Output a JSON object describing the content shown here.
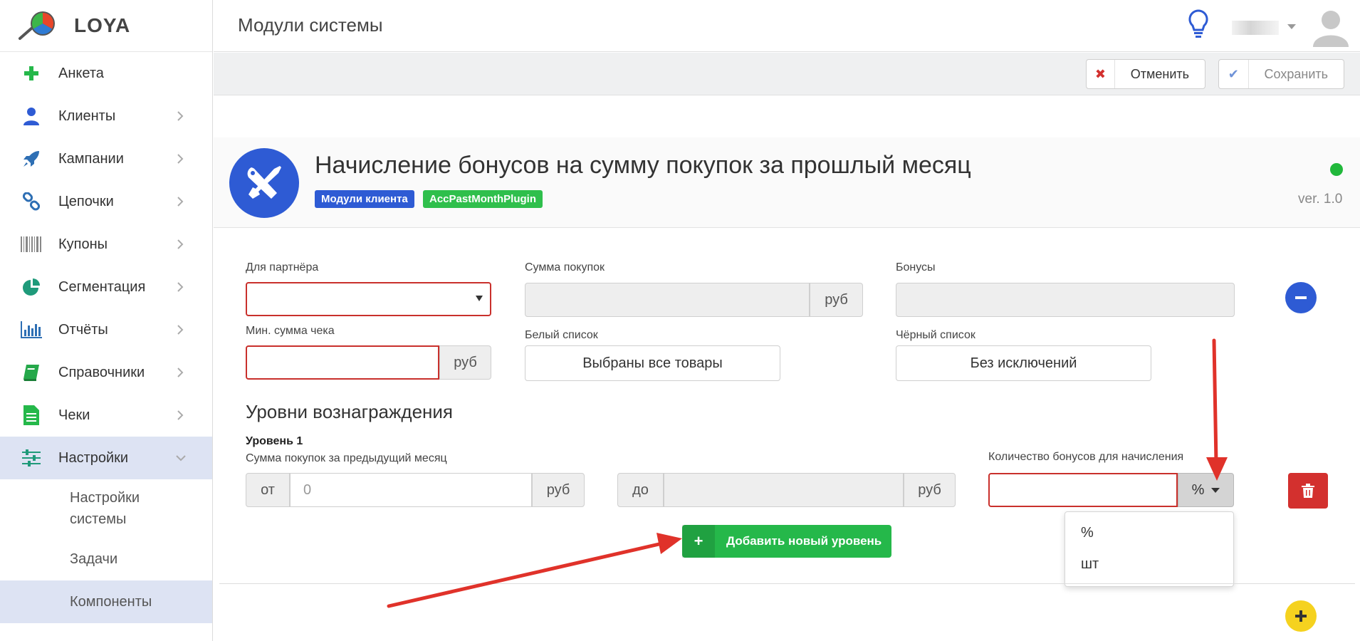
{
  "app": {
    "name": "LOYA"
  },
  "header": {
    "title": "Модули системы"
  },
  "sidebar": {
    "items": [
      {
        "label": "Анкета",
        "icon": "plus-icon"
      },
      {
        "label": "Клиенты",
        "icon": "person-icon"
      },
      {
        "label": "Кампании",
        "icon": "rocket-icon"
      },
      {
        "label": "Цепочки",
        "icon": "chain-icon"
      },
      {
        "label": "Купоны",
        "icon": "barcode-icon"
      },
      {
        "label": "Сегментация",
        "icon": "pie-chart-icon"
      },
      {
        "label": "Отчёты",
        "icon": "bar-chart-icon"
      },
      {
        "label": "Справочники",
        "icon": "book-icon"
      },
      {
        "label": "Чеки",
        "icon": "receipt-icon"
      },
      {
        "label": "Настройки",
        "icon": "sliders-icon"
      }
    ],
    "subitems": [
      {
        "label": "Настройки системы"
      },
      {
        "label": "Задачи"
      },
      {
        "label": "Компоненты"
      }
    ]
  },
  "toolbar": {
    "cancel_label": "Отменить",
    "save_label": "Сохранить"
  },
  "module": {
    "title": "Начисление бонусов на сумму покупок за прошлый месяц",
    "badges": [
      "Модули клиента",
      "AccPastMonthPlugin"
    ],
    "version": "ver. 1.0"
  },
  "form": {
    "partner_label": "Для партнёра",
    "partner_value": "",
    "sum_label": "Сумма покупок",
    "sum_unit": "руб",
    "bonus_label": "Бонусы",
    "min_check_label": "Мин. сумма чека",
    "min_check_unit": "руб",
    "whitelist_label": "Белый список",
    "whitelist_value": "Выбраны все товары",
    "blacklist_label": "Чёрный список",
    "blacklist_value": "Без исключений"
  },
  "levels": {
    "title": "Уровни вознаграждения",
    "level_name": "Уровень 1",
    "range_label": "Сумма покупок за предыдущий месяц",
    "from_prefix": "от",
    "from_value": "0",
    "from_unit": "руб",
    "to_prefix": "до",
    "to_unit": "руб",
    "bonus_amount_label": "Количество бонусов для начисления",
    "unit_selected": "%",
    "unit_options": [
      "%",
      "шт"
    ],
    "add_level_label": "Добавить новый уровень"
  },
  "colors": {
    "accent_blue": "#2e5bd4",
    "success_green": "#25b84a",
    "danger_red": "#d3302e",
    "warning_yellow": "#f5d21f",
    "annotation_red": "#e0322a"
  }
}
